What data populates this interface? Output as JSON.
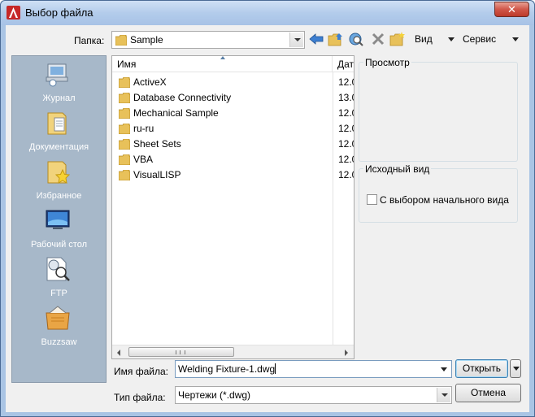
{
  "window": {
    "title": "Выбор файла",
    "close_label": "✕"
  },
  "toolbar": {
    "folder_label": "Папка:",
    "folder_value": "Sample",
    "view_label": "Вид",
    "tools_label": "Сервис"
  },
  "places": [
    {
      "label": "Журнал",
      "icon": "history-icon"
    },
    {
      "label": "Документация",
      "icon": "documents-folder-icon"
    },
    {
      "label": "Избранное",
      "icon": "favorites-folder-icon"
    },
    {
      "label": "Рабочий стол",
      "icon": "desktop-icon"
    },
    {
      "label": "FTP",
      "icon": "ftp-icon"
    },
    {
      "label": "Buzzsaw",
      "icon": "buzzsaw-icon"
    }
  ],
  "filelist": {
    "columns": [
      "Имя",
      "Дат"
    ],
    "rows": [
      {
        "name": "ActiveX",
        "date": "12.0"
      },
      {
        "name": "Database Connectivity",
        "date": "13.0"
      },
      {
        "name": "Mechanical Sample",
        "date": "12.0"
      },
      {
        "name": "ru-ru",
        "date": "12.0"
      },
      {
        "name": "Sheet Sets",
        "date": "12.0"
      },
      {
        "name": "VBA",
        "date": "12.0"
      },
      {
        "name": "VisualLISP",
        "date": "12.0"
      }
    ]
  },
  "preview": {
    "title": "Просмотр"
  },
  "initial_view": {
    "title": "Исходный вид",
    "checkbox_label": "С выбором начального вида",
    "checked": false
  },
  "filename": {
    "label": "Имя файла:",
    "value": "Welding Fixture-1.dwg"
  },
  "filetype": {
    "label": "Тип файла:",
    "value": "Чертежи (*.dwg)"
  },
  "buttons": {
    "open": "Открыть",
    "cancel": "Отмена"
  },
  "colors": {
    "titlebar": "#b3cceb",
    "places_panel": "#a7b8c9",
    "folder": "#e8c15a",
    "close": "#c8473a"
  }
}
